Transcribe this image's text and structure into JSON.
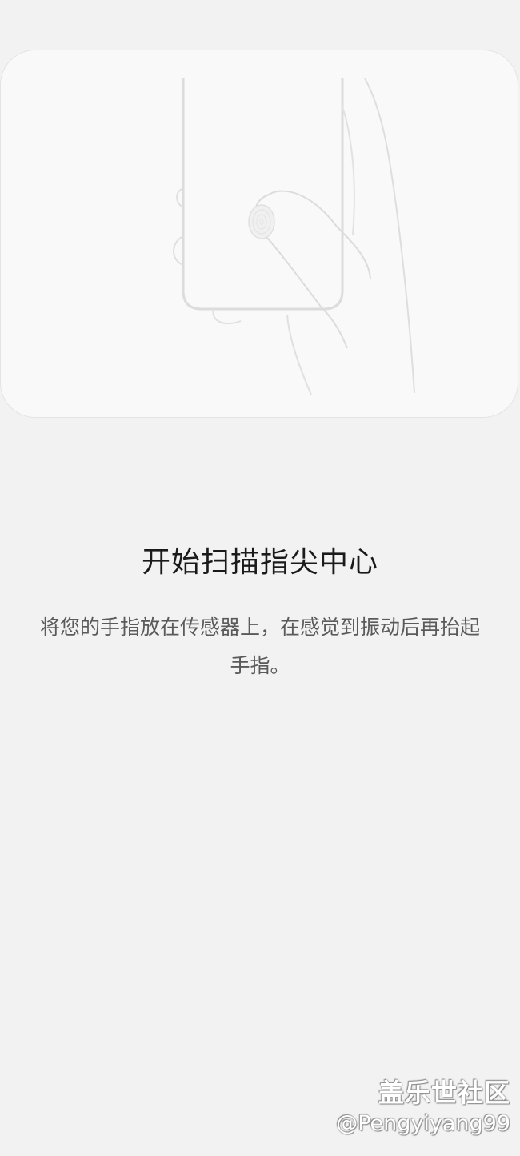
{
  "title": "开始扫描指尖中心",
  "instructions": "将您的手指放在传感器上，在感觉到振动后再抬起手指。",
  "watermark": {
    "community": "盖乐世社区",
    "user": "@Pengyiyang99"
  },
  "illustration": {
    "icon": "fingerprint-scan-illustration"
  },
  "colors": {
    "background": "#f2f2f2",
    "card": "#f9f9f9",
    "title": "#1a1a1a",
    "body_text": "#5a5a5a",
    "line_art": "#dcdcdc"
  }
}
